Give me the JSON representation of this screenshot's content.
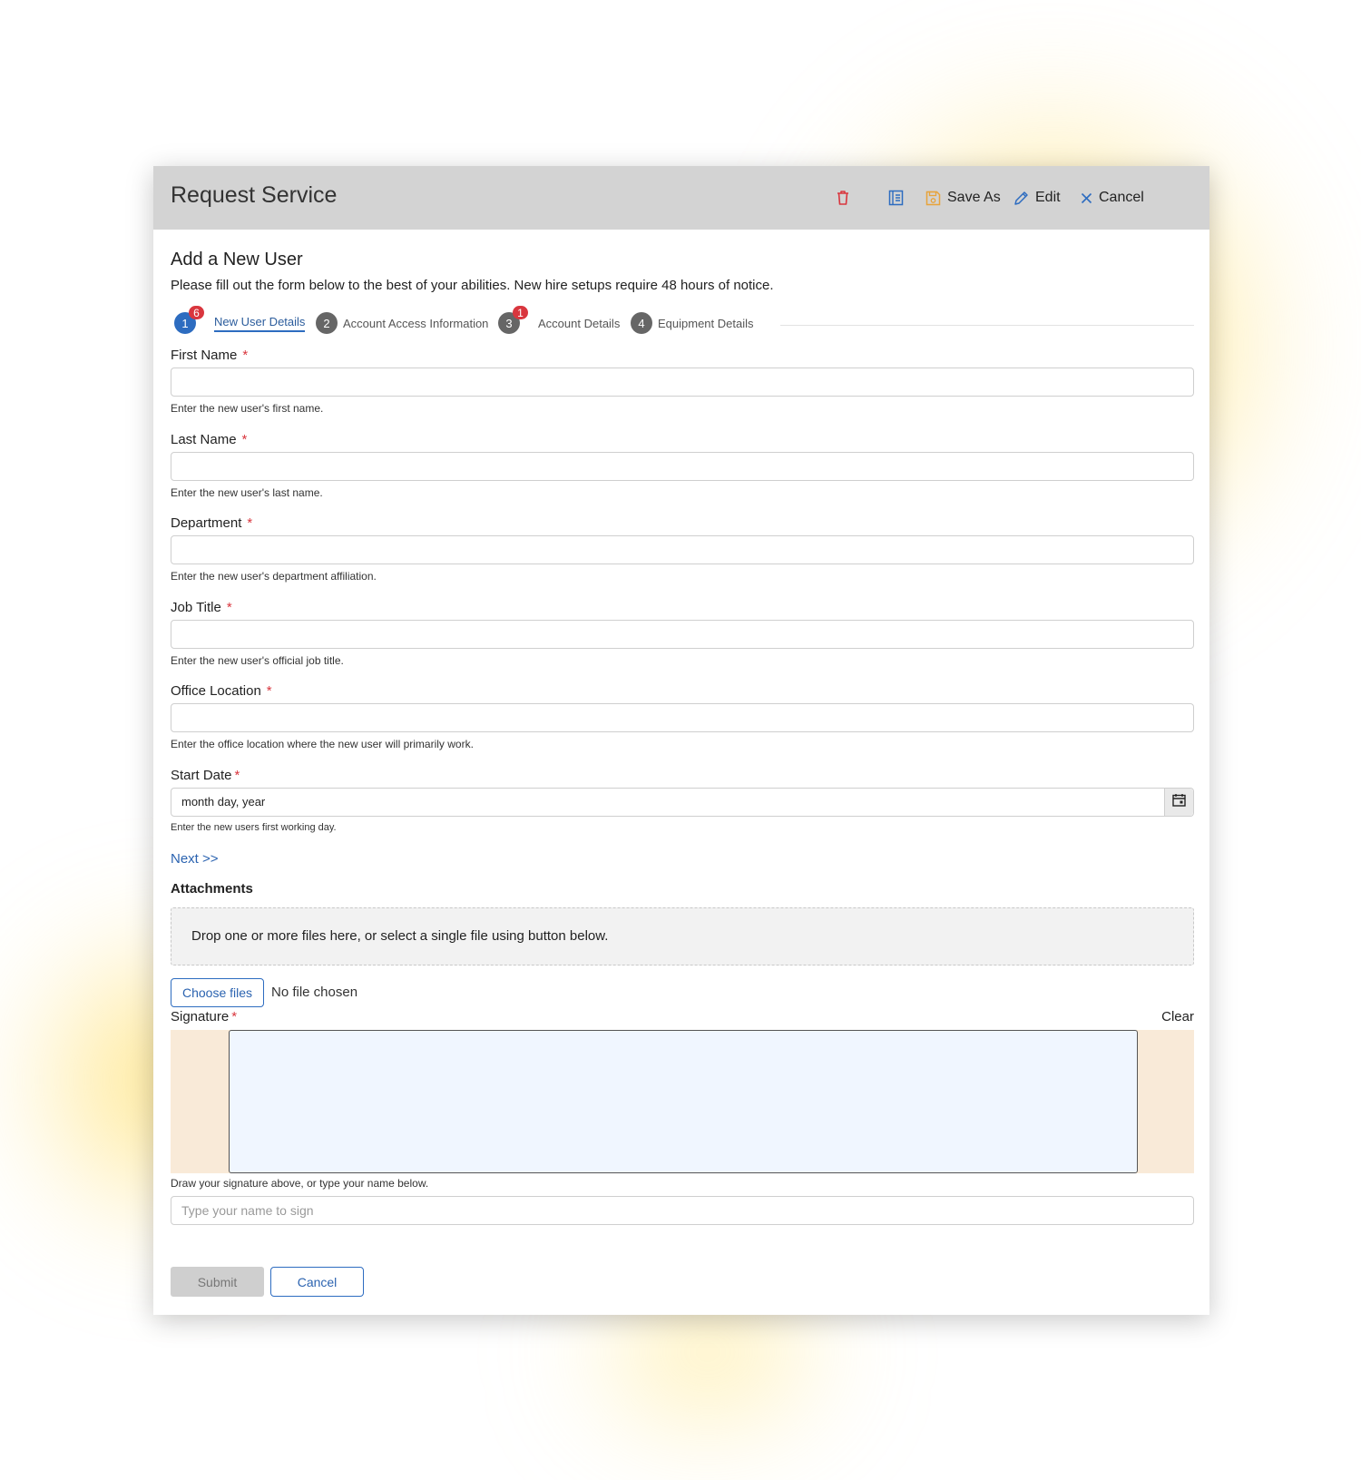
{
  "header": {
    "title": "Request Service",
    "save_as_label": "Save As",
    "edit_label": "Edit",
    "cancel_label": "Cancel",
    "icons": {
      "delete": "trash-icon",
      "view": "form-icon",
      "save_as": "save-icon",
      "edit": "pencil-icon",
      "cancel": "close-icon"
    },
    "colors": {
      "background": "#d3d3d3",
      "delete_icon": "#d9363e",
      "save_icon": "#e8a33a",
      "accent": "#2d6cc0"
    }
  },
  "form": {
    "heading": "Add a New User",
    "intro": "Please fill out the form below to the best of your abilities. New hire setups require 48 hours of notice."
  },
  "steps": [
    {
      "number": "1",
      "label": "New User Details",
      "badge": "6",
      "active": true
    },
    {
      "number": "2",
      "label": "Account Access Information",
      "badge": "",
      "active": false
    },
    {
      "number": "3",
      "label": "Account Details",
      "badge": "1",
      "active": false
    },
    {
      "number": "4",
      "label": "Equipment Details",
      "badge": "",
      "active": false
    }
  ],
  "fields": {
    "first_name": {
      "label": "First Name",
      "required": "*",
      "value": "",
      "help": "Enter the new user's first name."
    },
    "last_name": {
      "label": "Last Name",
      "required": "*",
      "value": "",
      "help": "Enter the new user's last name."
    },
    "department": {
      "label": "Department",
      "required": "*",
      "value": "",
      "help": "Enter the new user's department affiliation."
    },
    "job_title": {
      "label": "Job Title",
      "required": "*",
      "value": "",
      "help": "Enter the new user's official job title."
    },
    "office_location": {
      "label": "Office Location",
      "required": "*",
      "value": "",
      "help": "Enter the office location where the new user will primarily work."
    },
    "start_date": {
      "label": "Start Date",
      "required": "*",
      "value": "month day, year",
      "help": "Enter the new users first working day.",
      "icon": "calendar-icon"
    }
  },
  "next_link": "Next >>",
  "attachments": {
    "heading": "Attachments",
    "drop_text": "Drop one or more files here, or select a single file using button below.",
    "choose_label": "Choose files",
    "no_file": "No file chosen"
  },
  "signature": {
    "label": "Signature",
    "required": "*",
    "clear_label": "Clear",
    "help": "Draw your signature above, or type your name below.",
    "placeholder": "Type your name to sign"
  },
  "actions": {
    "submit_label": "Submit",
    "cancel_label": "Cancel"
  }
}
